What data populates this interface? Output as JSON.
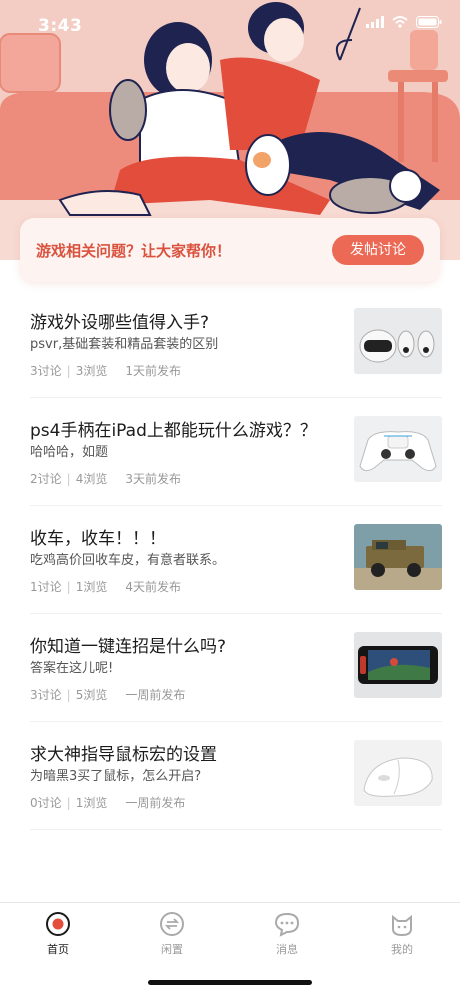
{
  "status_bar": {
    "time": "3:43"
  },
  "banner": {
    "text": "游戏相关问题？让大家帮你！",
    "button_label": "发帖讨论"
  },
  "posts": [
    {
      "title": "游戏外设哪些值得入手?",
      "subtitle": "psvr,基础套装和精品套装的区别",
      "discuss": "3讨论",
      "views": "3浏览",
      "time": "1天前发布",
      "thumb": "vr-headset-image"
    },
    {
      "title": "ps4手柄在iPad上都能玩什么游戏？？",
      "subtitle": "哈哈哈，如题",
      "discuss": "2讨论",
      "views": "4浏览",
      "time": "3天前发布",
      "thumb": "controller-image"
    },
    {
      "title": "收车，收车！！！",
      "subtitle": "吃鸡高价回收车皮，有意者联系。",
      "discuss": "1讨论",
      "views": "1浏览",
      "time": "4天前发布",
      "thumb": "jeep-image"
    },
    {
      "title": "你知道一键连招是什么吗?",
      "subtitle": "答案在这儿呢!",
      "discuss": "3讨论",
      "views": "5浏览",
      "time": "一周前发布",
      "thumb": "phone-game-image"
    },
    {
      "title": "求大神指导鼠标宏的设置",
      "subtitle": "为暗黑3买了鼠标，怎么开启?",
      "discuss": "0讨论",
      "views": "1浏览",
      "time": "一周前发布",
      "thumb": "mouse-image"
    }
  ],
  "tabbar": {
    "tabs": [
      {
        "label": "首页",
        "icon": "home-icon",
        "active": true
      },
      {
        "label": "闲置",
        "icon": "swap-icon",
        "active": false
      },
      {
        "label": "消息",
        "icon": "message-icon",
        "active": false
      },
      {
        "label": "我的",
        "icon": "cat-profile-icon",
        "active": false
      }
    ]
  },
  "colors": {
    "accent": "#ec6a55",
    "banner_text": "#d9533f",
    "hero_bg": "#f1c8bf"
  }
}
